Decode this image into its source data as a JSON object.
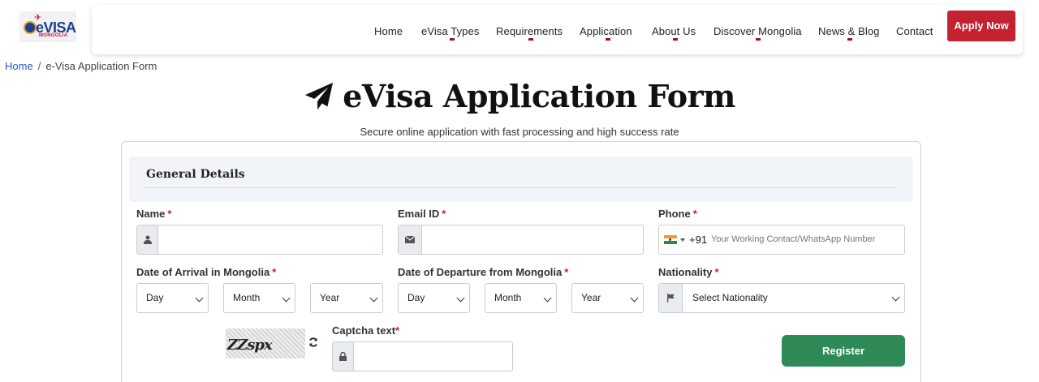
{
  "header": {
    "logo": {
      "text": "eVISA",
      "subtext": "MONGOLIA"
    },
    "nav": [
      {
        "label": "Home",
        "has_dropdown": false
      },
      {
        "label": "eVisa Types",
        "has_dropdown": true
      },
      {
        "label": "Requirements",
        "has_dropdown": true
      },
      {
        "label": "Application",
        "has_dropdown": true
      },
      {
        "label": "About Us",
        "has_dropdown": true
      },
      {
        "label": "Discover Mongolia",
        "has_dropdown": true
      },
      {
        "label": "News & Blog",
        "has_dropdown": true
      },
      {
        "label": "Contact",
        "has_dropdown": false
      }
    ],
    "apply_label": "Apply Now"
  },
  "breadcrumb": {
    "home": "Home",
    "separator": "/",
    "current": "e-Visa Application Form"
  },
  "page": {
    "title": "eVisa Application Form",
    "subtitle": "Secure online application with fast processing and high success rate"
  },
  "form": {
    "section_title": "General Details",
    "name": {
      "label": "Name",
      "required_mark": "*",
      "value": ""
    },
    "email": {
      "label": "Email ID",
      "required_mark": "*",
      "value": ""
    },
    "phone": {
      "label": "Phone",
      "required_mark": "*",
      "country_code": "+91",
      "placeholder": "Your Working Contact/WhatsApp Number"
    },
    "arrival": {
      "label": "Date of Arrival in Mongolia",
      "required_mark": "*",
      "day": "Day",
      "month": "Month",
      "year": "Year"
    },
    "departure": {
      "label": "Date of Departure from Mongolia",
      "required_mark": "*",
      "day": "Day",
      "month": "Month",
      "year": "Year"
    },
    "nationality": {
      "label": "Nationality",
      "required_mark": "*",
      "selected": "Select Nationality"
    },
    "captcha": {
      "label": "Captcha text",
      "required_mark": "*",
      "image_text": "ZZspx",
      "value": ""
    },
    "register_label": "Register"
  },
  "colors": {
    "accent_red": "#c42230",
    "link_blue": "#2b59c3",
    "register_green": "#2e8b57",
    "section_bg": "#f1f4f8"
  }
}
